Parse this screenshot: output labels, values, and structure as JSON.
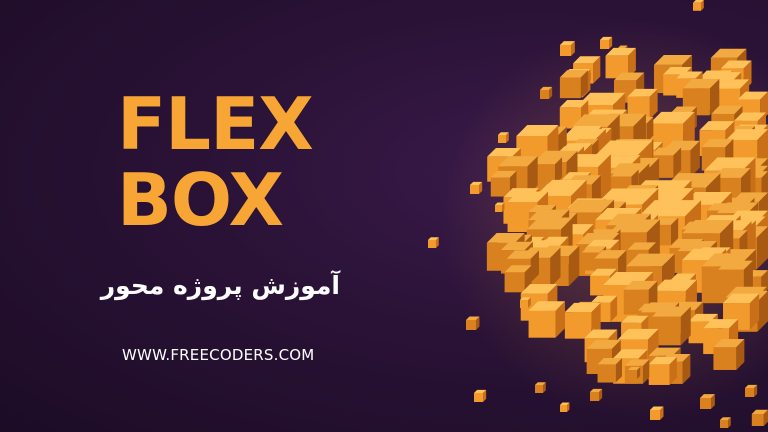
{
  "title": {
    "line1": "FLEX",
    "line2": "BOX"
  },
  "subtitle": "آموزش پروژه محور",
  "website": "WWW.FREECODERS.COM",
  "colors": {
    "accent": "#f7a534",
    "background": "#2a1236",
    "text": "#ffffff"
  },
  "illustration": "orange-voxel-cube-cluster"
}
